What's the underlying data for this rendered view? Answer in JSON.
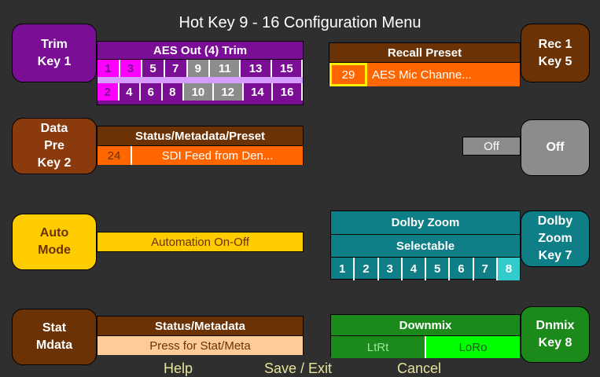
{
  "title": "Hot Key 9 - 16 Configuration Menu",
  "keys": {
    "trim": "Trim\nKey 1",
    "datapre": "Data\nPre\nKey 2",
    "auto": "Auto\nMode",
    "stat": "Stat\nMdata",
    "rec": "Rec 1\nKey 5",
    "off": "Off",
    "dolby": "Dolby\nZoom\nKey 7",
    "dnmix": "Dnmix\nKey 8"
  },
  "aes_trim": {
    "header": "AES Out (4) Trim",
    "row1": [
      {
        "label": "1",
        "state": "pink"
      },
      {
        "label": "3",
        "state": "pink"
      },
      {
        "label": "5",
        "state": "purple"
      },
      {
        "label": "7",
        "state": "purple"
      },
      {
        "label": "9",
        "state": "grey"
      },
      {
        "label": "11",
        "state": "grey"
      },
      {
        "label": "13",
        "state": "purple"
      },
      {
        "label": "15",
        "state": "purple"
      }
    ],
    "row2": [
      {
        "label": "2",
        "state": "pink"
      },
      {
        "label": "4",
        "state": "purple"
      },
      {
        "label": "6",
        "state": "purple"
      },
      {
        "label": "8",
        "state": "purple"
      },
      {
        "label": "10",
        "state": "grey"
      },
      {
        "label": "12",
        "state": "grey"
      },
      {
        "label": "14",
        "state": "purple"
      },
      {
        "label": "16",
        "state": "purple"
      }
    ]
  },
  "status_preset": {
    "header": "Status/Metadata/Preset",
    "number": "24",
    "value": "SDI Feed from Den..."
  },
  "automation": {
    "label": "Automation On-Off"
  },
  "status_meta": {
    "header": "Status/Metadata",
    "value": "Press for Stat/Meta"
  },
  "recall": {
    "header": "Recall Preset",
    "number": "29",
    "value": "AES Mic Channe..."
  },
  "off_field": {
    "value": "Off"
  },
  "dolby_zoom": {
    "header": "Dolby Zoom",
    "subheader": "Selectable",
    "channels": [
      "1",
      "2",
      "3",
      "4",
      "5",
      "6",
      "7",
      "8"
    ],
    "selected": "8"
  },
  "downmix": {
    "header": "Downmix",
    "options": [
      "LtRt",
      "LoRo"
    ],
    "selected": "LoRo"
  },
  "footer": {
    "help": "Help",
    "save": "Save / Exit",
    "cancel": "Cancel"
  },
  "colors": {
    "purple": "#7a0f96",
    "pink": "#ff00ff",
    "grey": "#8c8c8c",
    "brown": "#6b3205",
    "orange": "#ff6600",
    "yellow": "#ffcc00",
    "teal": "#0e7f86",
    "green": "#1b8a1b",
    "bright_green": "#00ff00"
  }
}
